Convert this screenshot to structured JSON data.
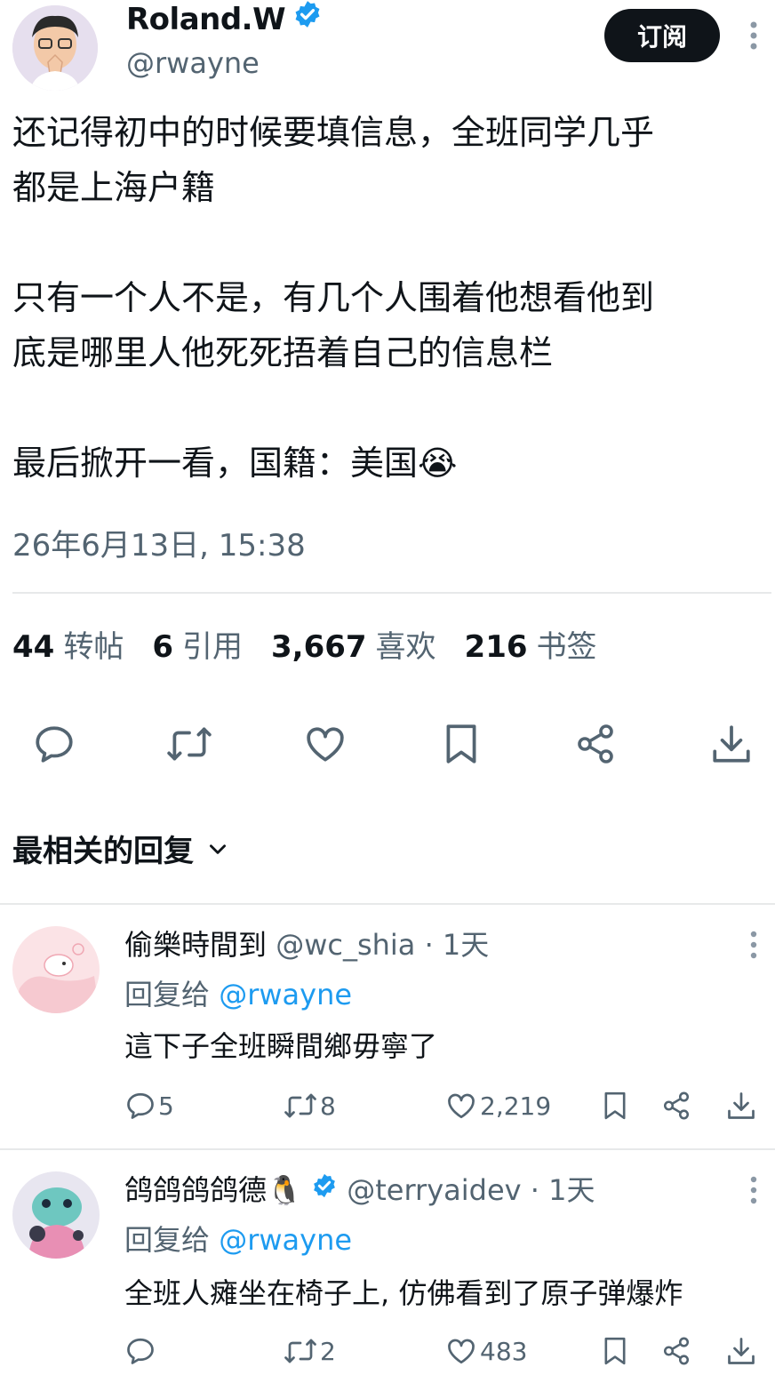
{
  "author": {
    "name": "Roland.W",
    "handle": "@rwayne",
    "subscribe_label": "订阅"
  },
  "tweet": {
    "text": "还记得初中的时候要填信息，全班同学几乎\n都是上海户籍\n\n只有一个人不是，有几个人围着他想看他到\n底是哪里人他死死捂着自己的信息栏\n\n最后掀开一看，国籍：美国😭",
    "timestamp": "26年6月13日, 15:38"
  },
  "stats": [
    {
      "count": "44",
      "label": "转帖"
    },
    {
      "count": "6",
      "label": "引用"
    },
    {
      "count": "3,667",
      "label": "喜欢"
    },
    {
      "count": "216",
      "label": "书签"
    }
  ],
  "action_icons": [
    "reply-icon",
    "retweet-icon",
    "like-icon",
    "bookmark-icon",
    "share-icon",
    "download-icon"
  ],
  "replies_header": {
    "label": "最相关的回复"
  },
  "replies": [
    {
      "name": "偷樂時間到",
      "handle": "@wc_shia",
      "age": "· 1天",
      "reply_to_prefix": "回复给",
      "reply_to": "@rwayne",
      "text": "這下子全班瞬間鄉毋寧了",
      "replies": "5",
      "retweets": "8",
      "likes": "2,219"
    },
    {
      "name": "鸽鸽鸽鸽德🐧",
      "handle": "@terryaidev",
      "age": "· 1天",
      "reply_to_prefix": "回复给",
      "reply_to": "@rwayne",
      "text": "全班人瘫坐在椅子上, 仿佛看到了原子弹爆炸",
      "replies": "",
      "retweets": "2",
      "likes": "483"
    }
  ],
  "colors": {
    "text": "#0f1419",
    "muted": "#536471",
    "link": "#1d9bf0",
    "verified": "#1d9bf0",
    "subscribe_bg": "#0f1419"
  }
}
